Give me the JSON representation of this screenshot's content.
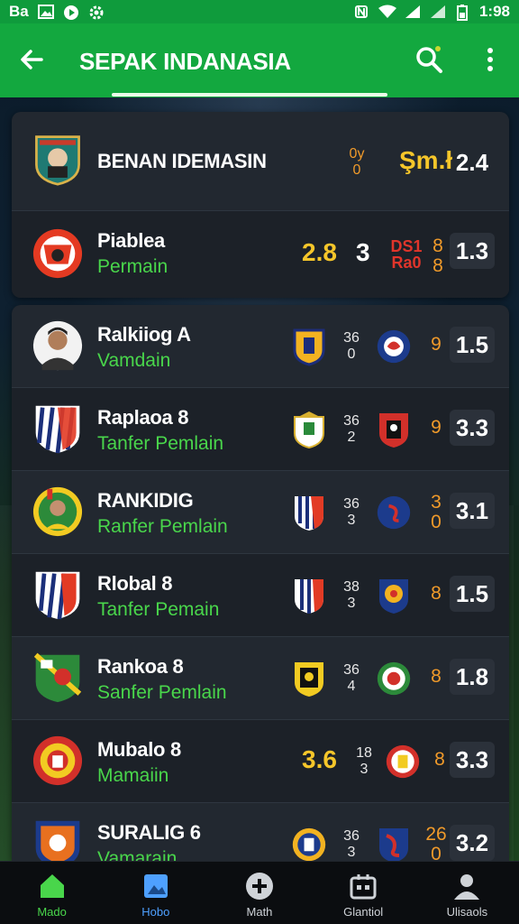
{
  "status_bar": {
    "left_text": "Ba",
    "time": "1:98"
  },
  "app_bar": {
    "title": "SEPAK INDANASIA"
  },
  "top_card": [
    {
      "name": "BENAN IDEMASIN",
      "stack_top": "0y",
      "stack_bottom": "0",
      "mid_text": "Şm.ł",
      "result": "2.4"
    },
    {
      "name": "Piablea",
      "sub": "Permain",
      "score": "2.8",
      "mid": "3",
      "red_top": "DS1",
      "red_bottom": "Ra0",
      "red_right_top": "8",
      "red_right_bottom": "8",
      "result": "1.3"
    }
  ],
  "list": [
    {
      "name": "Ralkiiog A",
      "sub": "Vamdain",
      "stack_top": "36",
      "stack_bottom": "0",
      "orange": "9",
      "result": "1.5"
    },
    {
      "name": "Raplaoa 8",
      "sub": "Tanfer Pemlain",
      "stack_top": "36",
      "stack_bottom": "2",
      "orange": "9",
      "result": "3.3"
    },
    {
      "name": "RANKIDIG",
      "sub": "Ranfer Pemlain",
      "stack_top": "36",
      "stack_bottom": "3",
      "orange_top": "3",
      "orange_bottom": "0",
      "result": "3.1"
    },
    {
      "name": "Rlobal 8",
      "sub": "Tanfer Pemain",
      "stack_top": "38",
      "stack_bottom": "3",
      "orange": "8",
      "result": "1.5"
    },
    {
      "name": "Rankoa 8",
      "sub": "Sanfer Pemlain",
      "stack_top": "36",
      "stack_bottom": "4",
      "orange": "8",
      "result": "1.8"
    },
    {
      "name": "Mubalo 8",
      "sub": "Mamaiin",
      "score": "3.6",
      "stack_top": "18",
      "stack_bottom": "3",
      "orange": "8",
      "result": "3.3"
    },
    {
      "name": "SURALIG 6",
      "sub": "Vamarain",
      "stack_top": "36",
      "stack_bottom": "3",
      "orange_top": "26",
      "orange_bottom": "0",
      "result": "3.2"
    }
  ],
  "bottom_nav": [
    {
      "label": "Mado",
      "icon": "home-icon"
    },
    {
      "label": "Hobo",
      "icon": "image-icon"
    },
    {
      "label": "Math",
      "icon": "plus-circle-icon"
    },
    {
      "label": "Glantiol",
      "icon": "calendar-icon"
    },
    {
      "label": "Ulisaols",
      "icon": "profile-icon"
    }
  ]
}
